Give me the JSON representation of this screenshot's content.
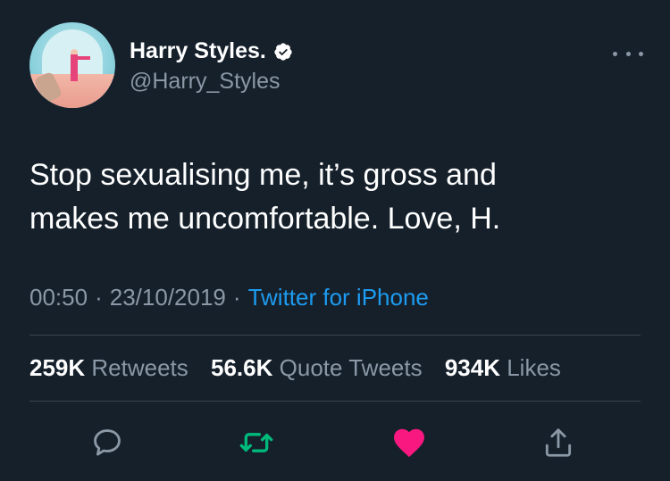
{
  "user": {
    "display_name": "Harry Styles.",
    "handle": "@Harry_Styles",
    "verified_icon": "verified-badge-icon",
    "avatar": "avatar"
  },
  "tweet": {
    "text": "Stop sexualising me, it’s gross and\nmakes me uncomfortable. Love, H.",
    "time": "00:50",
    "date": "23/10/2019",
    "separator": "·",
    "source": "Twitter for iPhone"
  },
  "stats": {
    "retweets_count": "259K",
    "retweets_label": "Retweets",
    "quote_count": "56.6K",
    "quote_label": "Quote Tweets",
    "likes_count": "934K",
    "likes_label": "Likes"
  },
  "actions": [
    "reply-icon",
    "retweet-icon",
    "like-icon",
    "share-icon"
  ],
  "colors": {
    "background": "#15202b",
    "secondary_text": "#8b98a5",
    "link": "#1d9bf0",
    "retweet": "#00ba7c",
    "like": "#f91880"
  }
}
